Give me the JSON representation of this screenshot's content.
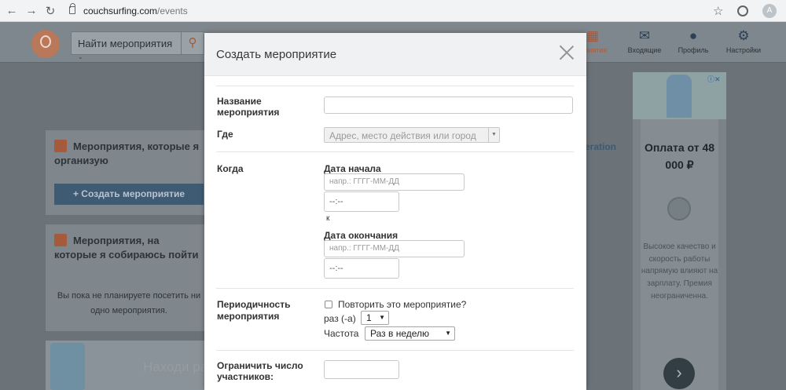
{
  "browser": {
    "url_domain": "couchsurfing.com",
    "url_path": "/events",
    "avatar_letter": "A"
  },
  "header": {
    "search_label": "Найти мероприятия",
    "nav": [
      {
        "label": "...риятия",
        "icon": "calendar-icon",
        "active": true
      },
      {
        "label": "Входящие",
        "icon": "envelope-icon"
      },
      {
        "label": "Профиль",
        "icon": "user-icon"
      },
      {
        "label": "Настройки",
        "icon": "gear-icon"
      }
    ]
  },
  "left": {
    "organize_title": "Мероприятия, которые я организую",
    "create_button": "+ Создать мероприятие",
    "attend_title": "Мероприятия, на которые я собираюсь пойти",
    "empty_text": "Вы пока не планируете посетить ни одно мероприятия.",
    "promo_text": "Находи работу",
    "side_link": "eration"
  },
  "ad": {
    "price": "Оплата от 48 000 ₽",
    "body": "Высокое качество и скорость работы напрямую влияют на зарплату. Премия неограниченна."
  },
  "modal": {
    "title": "Создать мероприятие",
    "name_label": "Название мероприятия",
    "name_value": "",
    "where_label": "Где",
    "where_placeholder": "Адрес, место действия или город",
    "when_label": "Когда",
    "start_label": "Дата начала",
    "start_date_placeholder": "напр.: ГГГГ-ММ-ДД",
    "start_time_value": "--:--",
    "to_label": "к",
    "end_label": "Дата окончания",
    "end_date_placeholder": "напр.: ГГГГ-ММ-ДД",
    "end_time_value": "--:--",
    "repeat_label": "Периодичность мероприятия",
    "repeat_checkbox_label": "Повторить это мероприятие?",
    "times_label": "раз (-а)",
    "times_value": "1",
    "frequency_label": "Частота",
    "frequency_value": "Раз в неделю",
    "limit_label": "Ограничить число участников:",
    "limit_value": ""
  }
}
